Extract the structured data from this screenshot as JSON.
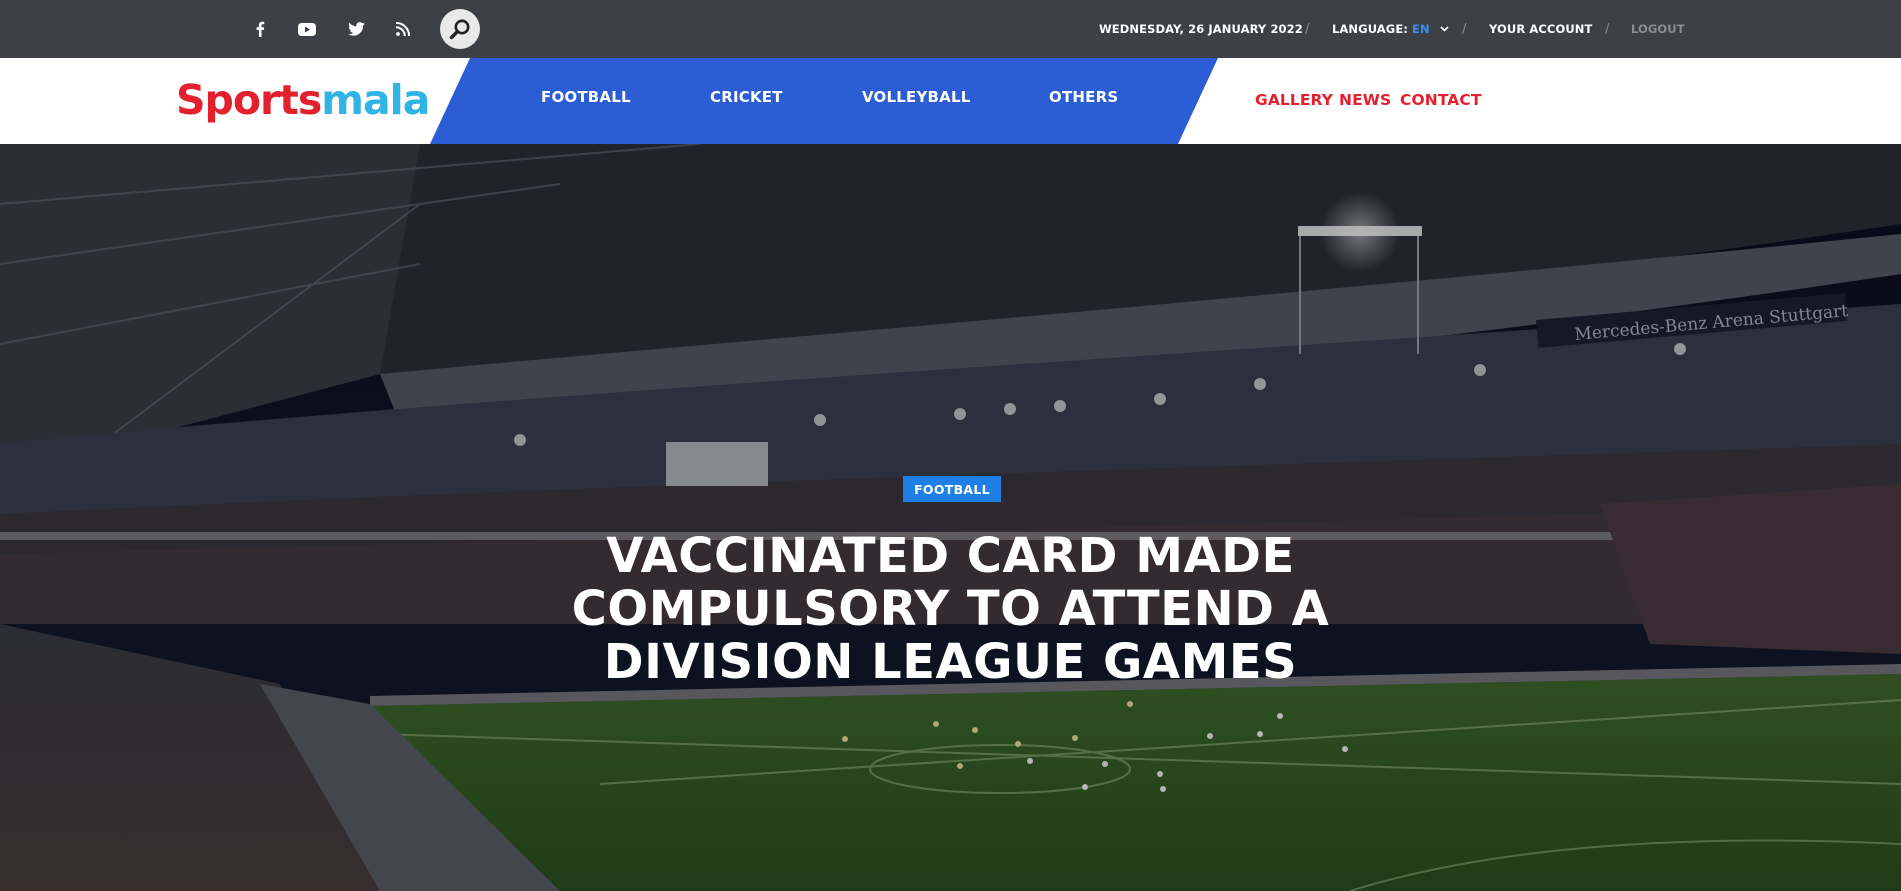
{
  "topbar": {
    "social": [
      {
        "name": "facebook-icon"
      },
      {
        "name": "youtube-icon"
      },
      {
        "name": "twitter-icon"
      },
      {
        "name": "rss-icon"
      }
    ],
    "search_icon": "search-icon",
    "date": "WEDNESDAY, 26 JANUARY 2022",
    "separator": "/",
    "language_label": "LANGUAGE:",
    "language_value": "EN",
    "account": "YOUR ACCOUNT",
    "logout": "LOGOUT"
  },
  "header": {
    "logo_part1": "Sports",
    "logo_part2": "mala",
    "nav": [
      "FOOTBALL",
      "CRICKET",
      "VOLLEYBALL",
      "OTHERS"
    ],
    "secondary": [
      "GALLERY",
      "NEWS",
      "CONTACT"
    ]
  },
  "hero": {
    "category": "FOOTBALL",
    "headline": "VACCINATED CARD MADE COMPULSORY TO ATTEND A DIVISION LEAGUE GAMES",
    "arena_banner": "Mercedes-Benz Arena Stuttgart"
  },
  "colors": {
    "topbar_bg": "#3d4044",
    "nav_band": "#2c5dd4",
    "accent_red": "#e5202e",
    "logo_blue": "#2fb4e5",
    "badge_blue": "#1f7fe5",
    "language_blue": "#3d8eea"
  }
}
